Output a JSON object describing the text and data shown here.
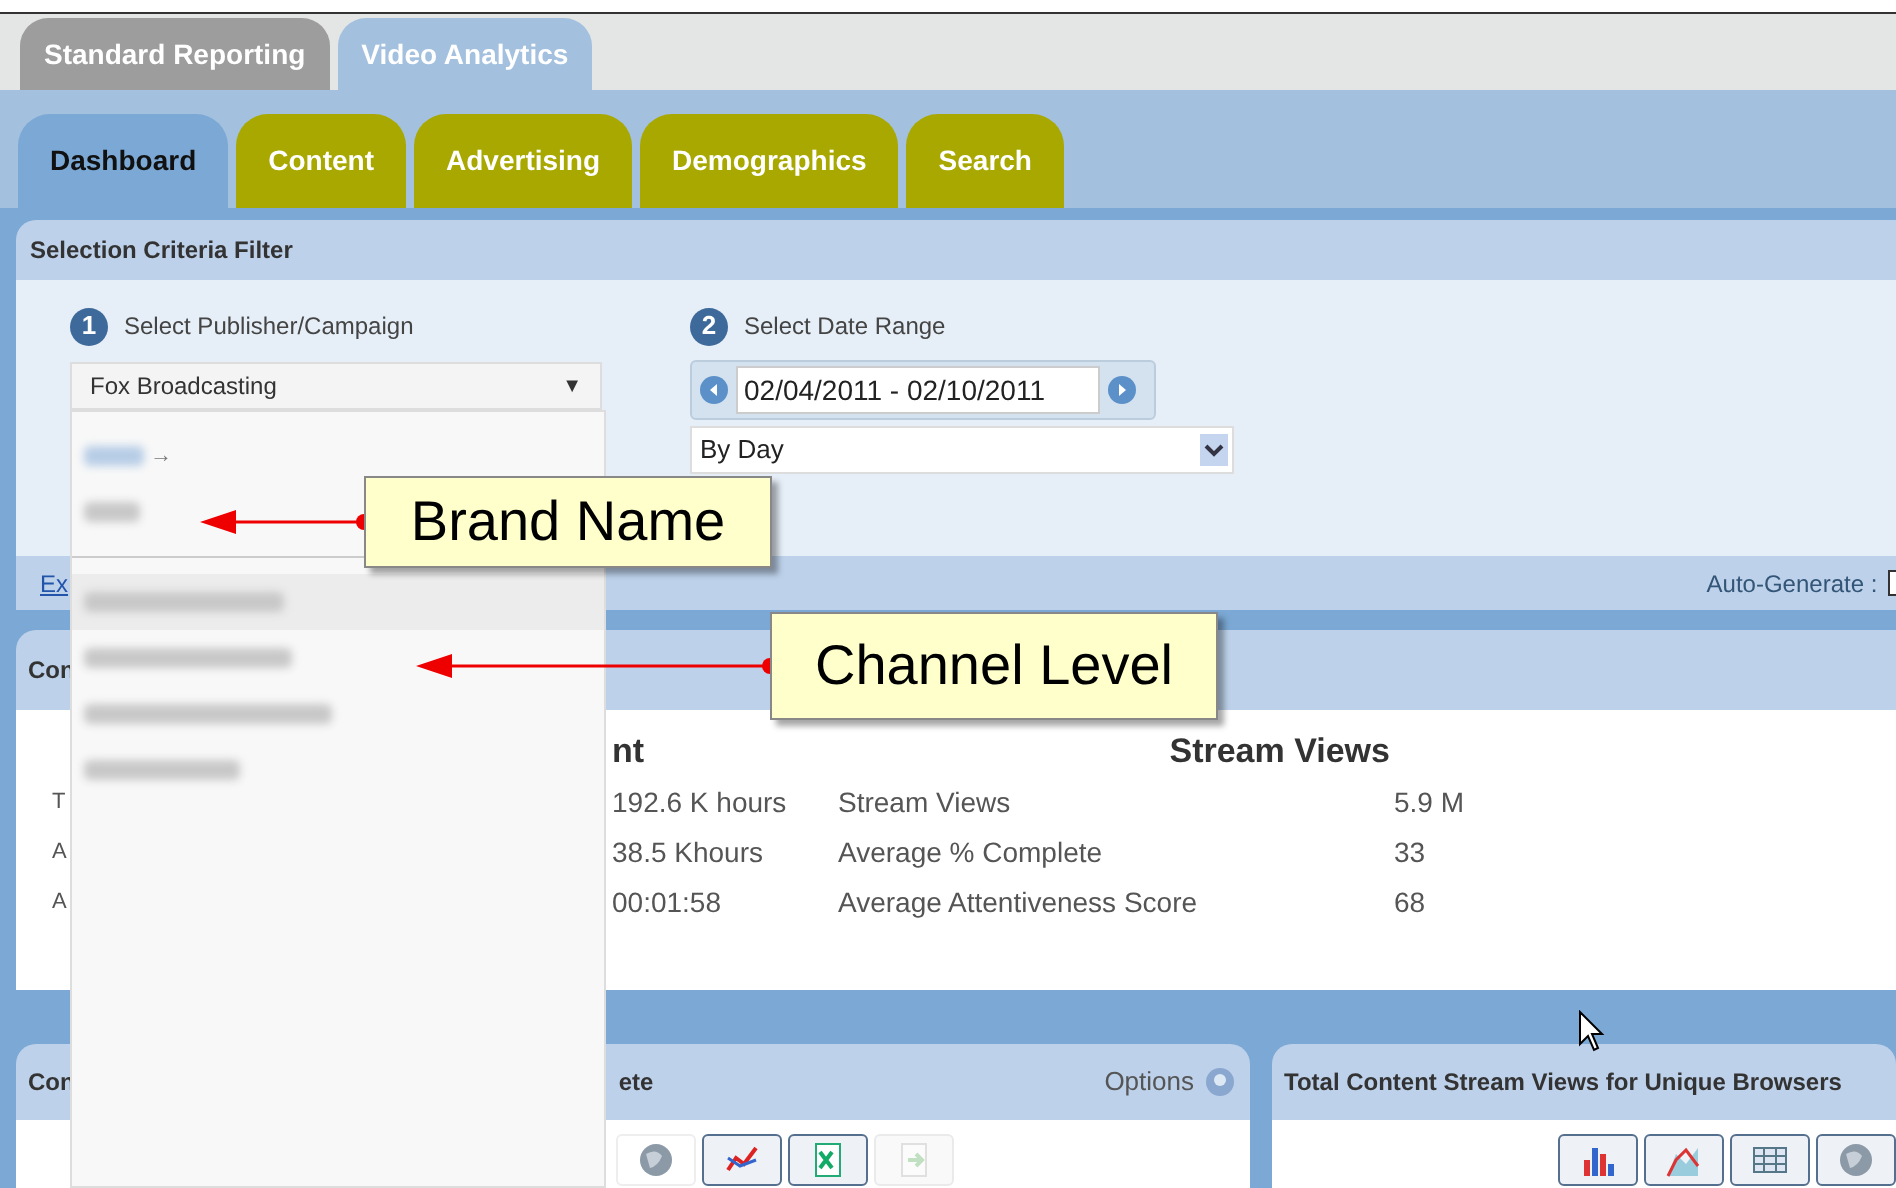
{
  "top_tabs": [
    {
      "label": "Standard Reporting",
      "selected": false
    },
    {
      "label": "Video Analytics",
      "selected": true
    }
  ],
  "nav_tabs": [
    {
      "label": "Dashboard",
      "selected": true
    },
    {
      "label": "Content",
      "selected": false
    },
    {
      "label": "Advertising",
      "selected": false
    },
    {
      "label": "Demographics",
      "selected": false
    },
    {
      "label": "Search",
      "selected": false
    }
  ],
  "filter": {
    "title": "Selection Criteria Filter",
    "steps": [
      {
        "number": "1",
        "label": "Select Publisher/Campaign"
      },
      {
        "number": "2",
        "label": "Select Date Range"
      }
    ],
    "publisher_select": {
      "value": "Fox Broadcasting",
      "arrow": "▼"
    },
    "date_range": {
      "value": "02/04/2011 - 02/10/2011"
    },
    "interval_select": {
      "value": "By Day"
    }
  },
  "dropdown": {
    "groups": [
      [
        {
          "kind": "with_arrow",
          "arrow": "→",
          "highlighted": false
        },
        {
          "kind": "plain",
          "highlighted": false
        }
      ],
      [
        {
          "kind": "plain",
          "highlighted": true
        },
        {
          "kind": "plain",
          "highlighted": false
        },
        {
          "kind": "plain",
          "highlighted": false
        },
        {
          "kind": "plain",
          "highlighted": false
        }
      ]
    ]
  },
  "toolbar": {
    "link": "Ex",
    "auto_generate": "Auto-Generate : ",
    "checked": false
  },
  "summary_panel": {
    "title": "Con",
    "headings": [
      "nt",
      "Stream Views"
    ],
    "rows": [
      {
        "label": "T",
        "value": "192.6 K hours",
        "metric": "Stream Views",
        "stat": "5.9 M"
      },
      {
        "label": "A",
        "value": "38.5 Khours",
        "metric": "Average % Complete",
        "stat": "33"
      },
      {
        "label": "A",
        "value": "00:01:58",
        "metric": "Average Attentiveness Score",
        "stat": "68"
      }
    ]
  },
  "lower_panels": [
    {
      "title": "Con",
      "title_end": "ete",
      "options": "Options",
      "tools": [
        {
          "kind": "globe",
          "disabled": false
        },
        {
          "kind": "line",
          "disabled": false
        },
        {
          "kind": "excel",
          "disabled": false
        },
        {
          "kind": "export",
          "disabled": true
        }
      ]
    },
    {
      "title": "Total Content Stream Views for Unique Browsers",
      "tools": [
        {
          "kind": "bar",
          "disabled": false
        },
        {
          "kind": "area",
          "disabled": false
        },
        {
          "kind": "table",
          "disabled": false
        },
        {
          "kind": "globe",
          "disabled": false
        }
      ]
    }
  ],
  "callouts": [
    {
      "text": "Brand Name"
    },
    {
      "text": "Channel Level"
    }
  ]
}
